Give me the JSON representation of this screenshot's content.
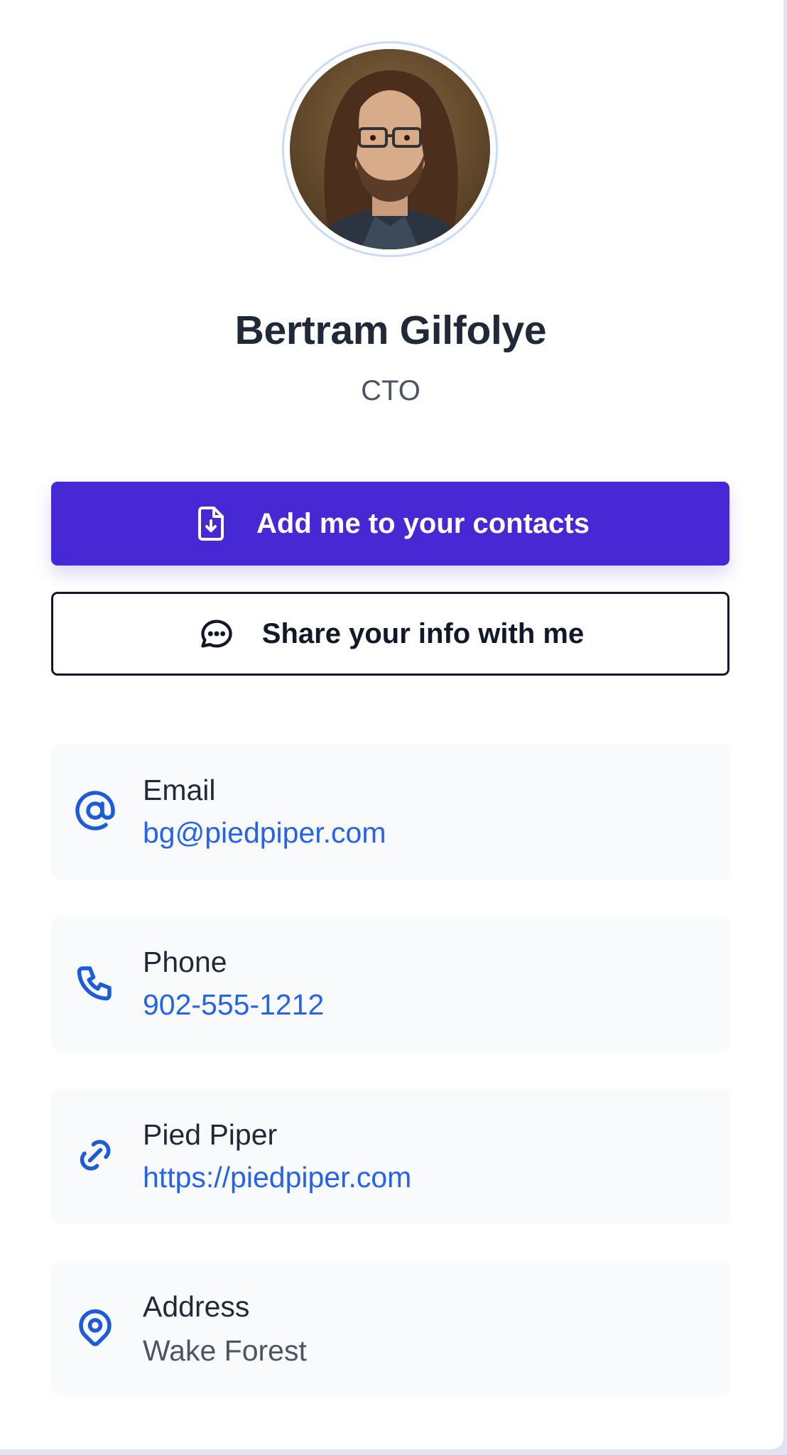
{
  "profile": {
    "name": "Bertram Gilfolye",
    "title": "CTO",
    "avatar_alt": "Bertram Gilfolye"
  },
  "actions": {
    "add_contact_label": "Add me to your contacts",
    "add_contact_icon": "file-download-icon",
    "share_info_label": "Share your info with me",
    "share_info_icon": "chat-bubble-icon"
  },
  "contact_items": {
    "email": {
      "label": "Email",
      "value": "bg@piedpiper.com",
      "icon": "at-sign-icon"
    },
    "phone": {
      "label": "Phone",
      "value": "902-555-1212",
      "icon": "phone-icon"
    },
    "website": {
      "label": "Pied Piper",
      "value": "https://piedpiper.com",
      "icon": "link-icon"
    },
    "address": {
      "label": "Address",
      "value": "Wake Forest",
      "icon": "map-pin-icon"
    }
  },
  "colors": {
    "primary": "#4628d4",
    "link": "#2563eb",
    "icon": "#1d5bd8",
    "text": "#1f2937",
    "muted": "#4b5563",
    "item_background": "#f8fafc"
  }
}
